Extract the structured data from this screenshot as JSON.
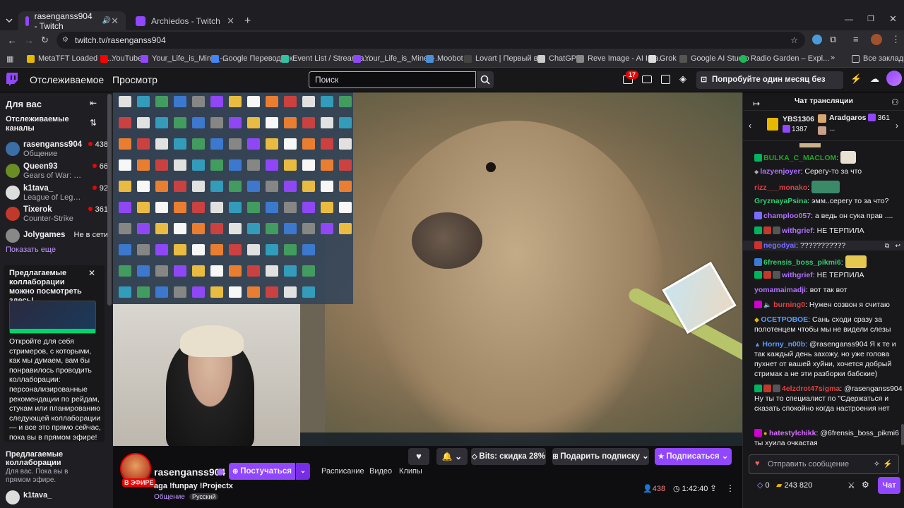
{
  "browser": {
    "tabs": [
      {
        "title": "rasenganss904 - Twitch",
        "active": true
      },
      {
        "title": "Archiedos - Twitch",
        "active": false
      }
    ],
    "url": "twitch.tv/rasenganss904",
    "bookmarks": [
      {
        "label": "MetaTFT Loaded Di...",
        "color": "#e6b800"
      },
      {
        "label": "YouTube",
        "color": "#ff0000"
      },
      {
        "label": "Your_Life_is_Mine_-...",
        "color": "#9146ff"
      },
      {
        "label": "Google Переводчик",
        "color": "#4285f4"
      },
      {
        "label": "Event List / Streamla...",
        "color": "#31c3a2"
      },
      {
        "label": "Your_Life_is_Mine_-...",
        "color": "#9146ff"
      },
      {
        "label": "Moobot",
        "color": "#4a90d9"
      },
      {
        "label": "Lovart | Первый в...",
        "color": "#222"
      },
      {
        "label": "ChatGPT",
        "color": "#ccc"
      },
      {
        "label": "Reve Image - AI Ima...",
        "color": "#888"
      },
      {
        "label": "Grok",
        "color": "#ddd"
      },
      {
        "label": "Google AI Studio",
        "color": "#555"
      },
      {
        "label": "Radio Garden – Expl...",
        "color": "#1db954"
      }
    ],
    "all_bookmarks": "Все закладки"
  },
  "topnav": {
    "following": "Отслеживаемое",
    "browse": "Просмотр",
    "search_placeholder": "Поиск",
    "notifications_count": "17",
    "promo": "Попробуйте один месяц без рекламы"
  },
  "sidebar": {
    "for_you": "Для вас",
    "followed_header": "Отслеживаемые каналы",
    "channels": [
      {
        "name": "rasenganss904",
        "game": "Общение",
        "viewers": "438",
        "color": "#3a6ea5"
      },
      {
        "name": "Queen93",
        "game": "Gears of War: E...",
        "viewers": "66",
        "color": "#6b8e23"
      },
      {
        "name": "k1tava_",
        "game": "League of Lege...",
        "viewers": "92",
        "color": "#ddd"
      },
      {
        "name": "Tixerok",
        "game": "Counter-Strike",
        "viewers": "361",
        "color": "#c0392b"
      },
      {
        "name": "Jolygames",
        "game": "",
        "viewers": "",
        "status": "Не в сети",
        "color": "#888"
      }
    ],
    "show_more": "Показать еще",
    "collab_title": "Предлагаемые коллаборации можно посмотреть здесь!",
    "collab_text": "Откройте для себя стримеров, с которыми, как мы думаем, вам бы понравилось проводить коллаборации: персонализированные рекомендации по рейдам, стукам или планированию следующей коллаборации — и все это прямо сейчас, пока вы в прямом эфире!",
    "collab_section_title": "Предлагаемые коллаборации",
    "collab_section_sub": "Для вас. Пока вы в прямом эфире.",
    "bottom_channel": "k1tava_"
  },
  "channel": {
    "live_badge": "В ЭФИРЕ",
    "name": "rasenganss904",
    "follow": "Постучаться",
    "schedule": "Расписание",
    "video": "Видео",
    "clips": "Клипы",
    "bits": "Bits: скидка 28%",
    "gift": "Подарить подписку",
    "subscribe": "Подписаться",
    "title": "aga !funpay !Projectx",
    "category": "Общение",
    "language": "Русский",
    "viewers": "438",
    "uptime": "1:42:40"
  },
  "chat": {
    "header": "Чат трансляции",
    "gifters": [
      {
        "name": "YBS1306",
        "count": "1387"
      },
      {
        "name": "Aradgaros",
        "count": "361"
      }
    ],
    "messages": [
      {
        "user": "BULKA_C_MACLOM",
        "color": "#1fa823",
        "text": ""
      },
      {
        "user": "lazyenjoyer",
        "color": "#b070ff",
        "text": "Серегу-то за что"
      },
      {
        "user": "rizz___monako",
        "color": "#e04040",
        "text": ""
      },
      {
        "user": "GryznayaPsina",
        "color": "#2ecc71",
        "text": "эмм..серегу то за что?"
      },
      {
        "user": "champloo057",
        "color": "#b070ff",
        "text": "а ведь он сука прав ...."
      },
      {
        "user": "withgrief",
        "color": "#b070ff",
        "text": "НЕ ТЕРПИЛА"
      },
      {
        "user": "negodyai",
        "color": "#7a6cff",
        "text": "???????????"
      },
      {
        "user": "6frensis_boss_pikmi6",
        "color": "#2ecc71",
        "text": ""
      },
      {
        "user": "withgrief",
        "color": "#b070ff",
        "text": "НЕ ТЕРПИЛА"
      },
      {
        "user": "yomamaimadji",
        "color": "#b070ff",
        "text": "вот так вот"
      },
      {
        "user": "burning0",
        "color": "#e04040",
        "text": "Нужен созвон я считаю"
      },
      {
        "user": "ОСЕТРОВОЕ",
        "color": "#5b9bff",
        "text": "Сань сходи сразу за полотенцем чтобы мы не видели слезы"
      },
      {
        "user": "Horny_n00b",
        "color": "#5b9bff",
        "text": "@rasenganss904 Я к те и так каждый день захожу, но уже голова пухнет от вашей хуйни, хочется добрый стримак а не эти разборки бабские)"
      },
      {
        "user": "4elzdrot47sigma",
        "color": "#e04040",
        "text": "@rasenganss904 Ну ты то специалист по \"Сдержаться и сказать спокойно когда настроения нет"
      },
      {
        "user": "hatestylchikk",
        "color": "#d86cff",
        "text": "@6frensis_boss_pikmi6 ты хуила очкастая"
      }
    ],
    "input_placeholder": "Отправить сообщение",
    "points_count": "0",
    "channel_points": "243 820",
    "chat_button": "Чат"
  }
}
